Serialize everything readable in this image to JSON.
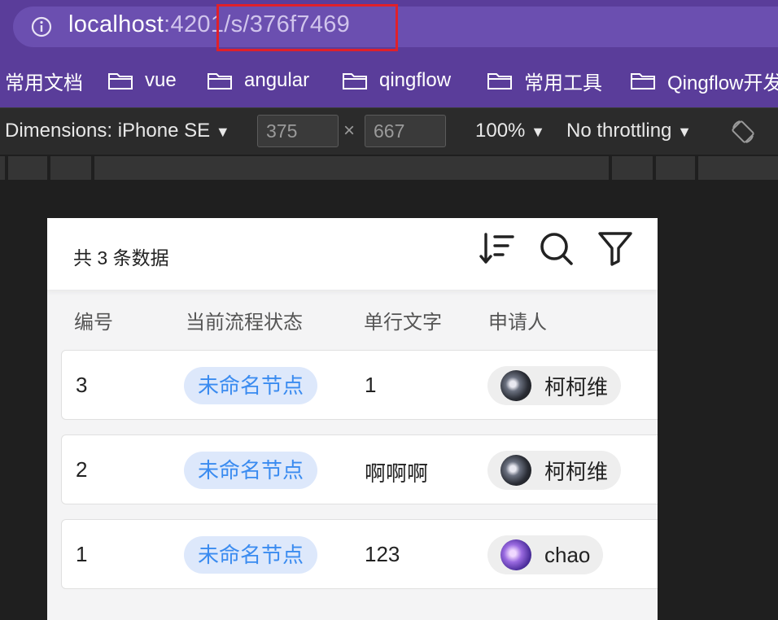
{
  "browser": {
    "url_host": "localhost",
    "url_rest": ":4201/s/376f7469"
  },
  "bookmarks": [
    {
      "label": "常用文档",
      "icon": "none"
    },
    {
      "label": "vue",
      "icon": "folder-icon"
    },
    {
      "label": "angular",
      "icon": "folder-icon"
    },
    {
      "label": "qingflow",
      "icon": "folder-icon"
    },
    {
      "label": "常用工具",
      "icon": "folder-icon"
    },
    {
      "label": "Qingflow开发",
      "icon": "folder-icon"
    }
  ],
  "devtools": {
    "dimensions": "Dimensions: iPhone SE",
    "width": "375",
    "times": "×",
    "height": "667",
    "zoom": "100%",
    "throttling": "No throttling"
  },
  "app": {
    "count_text": "共 3 条数据",
    "icons": [
      "sort-icon",
      "search-icon",
      "filter-icon"
    ],
    "columns": [
      "编号",
      "当前流程状态",
      "单行文字",
      "申请人"
    ],
    "rows": [
      {
        "id": "3",
        "status": "未命名节点",
        "text": "1",
        "applicant": "柯柯维",
        "avatar": "dark"
      },
      {
        "id": "2",
        "status": "未命名节点",
        "text": "啊啊啊",
        "applicant": "柯柯维",
        "avatar": "dark"
      },
      {
        "id": "1",
        "status": "未命名节点",
        "text": "123",
        "applicant": "chao",
        "avatar": "purple"
      }
    ]
  },
  "colors": {
    "browser_purple": "#5a3d9a",
    "tag_bg": "#dde8fb",
    "tag_text": "#3a8bf0",
    "highlight_red": "#e0202a"
  }
}
